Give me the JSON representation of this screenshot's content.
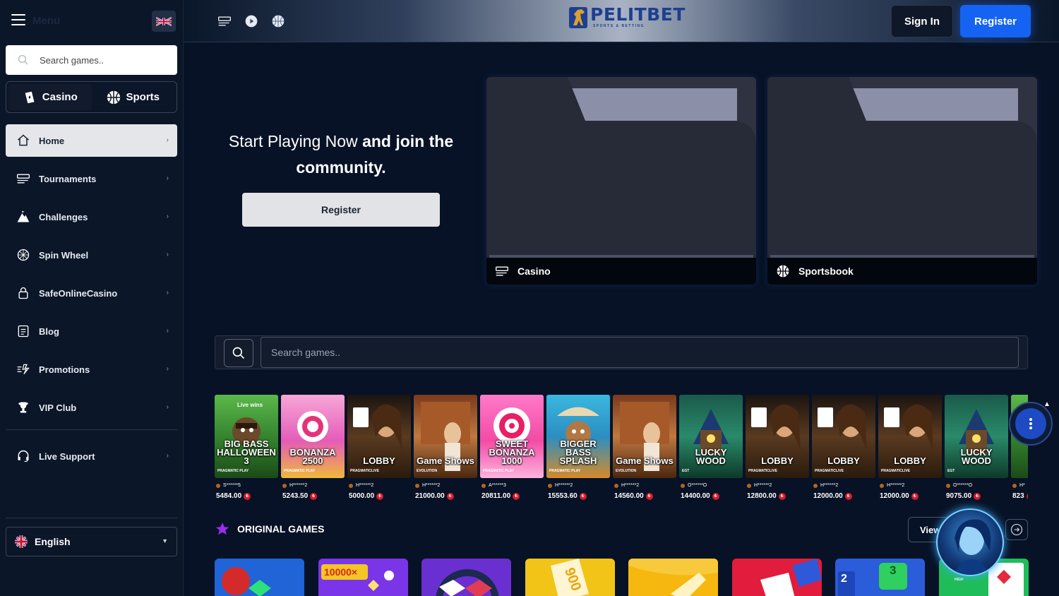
{
  "sidebar": {
    "menu_label": "Menu",
    "search_placeholder": "Search games..",
    "modes": [
      {
        "label": "Casino",
        "icon": "cards-icon"
      },
      {
        "label": "Sports",
        "icon": "basketball-icon"
      }
    ],
    "items": [
      {
        "label": "Home",
        "icon": "home-icon",
        "active": true
      },
      {
        "label": "Tournaments",
        "icon": "tournament-icon"
      },
      {
        "label": "Challenges",
        "icon": "mountain-icon"
      },
      {
        "label": "Spin Wheel",
        "icon": "wheel-icon"
      },
      {
        "label": "SafeOnlineCasino",
        "icon": "lock-icon"
      },
      {
        "label": "Blog",
        "icon": "document-icon"
      },
      {
        "label": "Promotions",
        "icon": "promotions-icon"
      },
      {
        "label": "VIP Club",
        "icon": "trophy-icon"
      },
      {
        "label": "Live Support",
        "icon": "headset-icon"
      }
    ],
    "language": "English"
  },
  "topbar": {
    "logo_text": "PELITBET",
    "logo_tagline": "SPORTS & BETTING",
    "signin": "Sign In",
    "register": "Register"
  },
  "hero": {
    "text_plain": "Start Playing Now",
    "text_bold": "and join the community.",
    "register": "Register",
    "cards": [
      {
        "label": "Casino",
        "icon": "casino-icon"
      },
      {
        "label": "Sportsbook",
        "icon": "sportsbook-icon"
      }
    ]
  },
  "search": {
    "placeholder": "Search games.."
  },
  "live_wins": {
    "label": "Live wins",
    "currency_symbol": "₺",
    "items": [
      {
        "game": "BIG BASS HALLOWEEN 3",
        "provider": "PRAGMATIC PLAY",
        "user": "S******5",
        "amount": "5484.00"
      },
      {
        "game": "BONANZA 2500",
        "provider": "PRAGMATIC PLAY",
        "user": "H******2",
        "amount": "5243.50"
      },
      {
        "game": "LOBBY",
        "provider": "PRAGMATICLIVE",
        "user": "H******2",
        "amount": "5000.00"
      },
      {
        "game": "Game Shows",
        "provider": "EVOLUTION",
        "user": "H******2",
        "amount": "21000.00"
      },
      {
        "game": "SWEET BONANZA 1000",
        "provider": "PRAGMATIC PLAY",
        "user": "A******3",
        "amount": "20811.00"
      },
      {
        "game": "BIGGER BASS SPLASH",
        "provider": "PRAGMATIC PLAY",
        "user": "H******2",
        "amount": "15553.60"
      },
      {
        "game": "Game Shows",
        "provider": "EVOLUTION",
        "user": "H******2",
        "amount": "14560.00"
      },
      {
        "game": "LUCKY WOOD",
        "provider": "EGT",
        "user": "O******O",
        "amount": "14400.00"
      },
      {
        "game": "LOBBY",
        "provider": "PRAGMATICLIVE",
        "user": "H******2",
        "amount": "12800.00"
      },
      {
        "game": "LOBBY",
        "provider": "PRAGMATICLIVE",
        "user": "H******2",
        "amount": "12000.00"
      },
      {
        "game": "LOBBY",
        "provider": "PRAGMATICLIVE",
        "user": "H******2",
        "amount": "12000.00"
      },
      {
        "game": "LUCKY WOOD",
        "provider": "EGT",
        "user": "O******O",
        "amount": "9075.00"
      },
      {
        "game": "",
        "provider": "",
        "user": "H*",
        "amount": "823"
      }
    ]
  },
  "original_games": {
    "title": "ORIGINAL GAMES",
    "view_all": "View",
    "badges": [
      "10000×",
      "900",
      "3",
      "2",
      "HIGH"
    ]
  },
  "colors": {
    "background": "#071226",
    "sidebar": "#0b1628",
    "accent_blue": "#1463f3",
    "currency_red": "#d61a2a"
  }
}
